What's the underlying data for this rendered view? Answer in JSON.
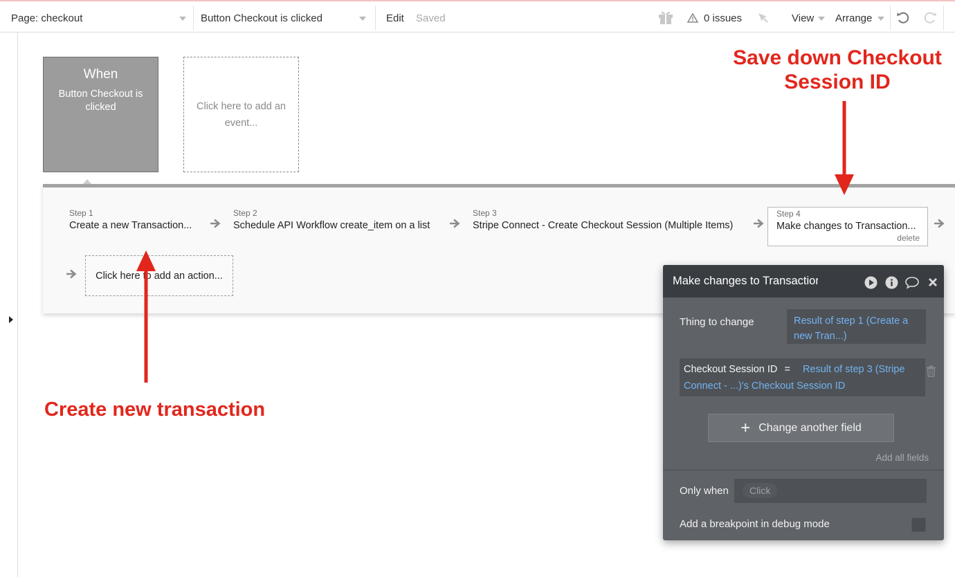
{
  "toolbar": {
    "page_selector": "Page: checkout",
    "event_selector": "Button Checkout is clicked",
    "edit_label": "Edit",
    "saved_label": "Saved",
    "issues_label": "0 issues",
    "view_label": "View",
    "arrange_label": "Arrange"
  },
  "event": {
    "when_title": "When",
    "when_subtitle": "Button Checkout is clicked",
    "add_event_placeholder": "Click here to add an event..."
  },
  "steps": [
    {
      "number": "Step 1",
      "label": "Create a new Transaction..."
    },
    {
      "number": "Step 2",
      "label": "Schedule API Workflow create_item on a list"
    },
    {
      "number": "Step 3",
      "label": "Stripe Connect - Create Checkout Session (Multiple Items)"
    },
    {
      "number": "Step 4",
      "label": "Make changes to Transaction...",
      "delete_label": "delete"
    }
  ],
  "add_action_placeholder": "Click here to add an action...",
  "property_editor": {
    "title": "Make changes to Transaction...",
    "thing_to_change_label": "Thing to change",
    "thing_to_change_value": "Result of step 1 (Create a new Tran...)",
    "field_name": "Checkout Session ID",
    "field_operator": "=",
    "field_value": "Result of step 3 (Stripe Connect - ...)'s Checkout Session ID",
    "change_another_label": "Change another field",
    "add_all_fields_label": "Add all fields",
    "only_when_label": "Only when",
    "only_when_placeholder": "Click",
    "breakpoint_label": "Add a breakpoint in debug mode"
  },
  "annotations": {
    "save_session_line1": "Save down Checkout",
    "save_session_line2": "Session ID",
    "create_transaction": "Create new transaction"
  },
  "colors": {
    "annotation_red": "#e2261c",
    "link_blue": "#73b2f2",
    "editor_bg": "#5f6367",
    "editor_header": "#393d42"
  }
}
